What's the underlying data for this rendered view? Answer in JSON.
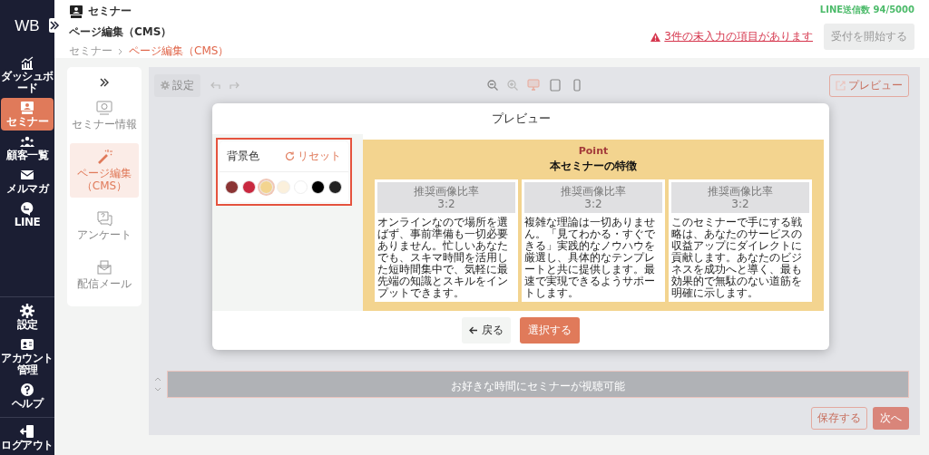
{
  "sidebar": {
    "logo": "WB",
    "items": [
      {
        "label": "ダッシュボード",
        "selected": false
      },
      {
        "label": "セミナー",
        "selected": true
      },
      {
        "label": "顧客一覧",
        "selected": false
      },
      {
        "label": "メルマガ",
        "selected": false
      },
      {
        "label": "LINE",
        "selected": false
      }
    ],
    "bottom_items": [
      {
        "label": "設定"
      },
      {
        "label": "アカウント管理"
      },
      {
        "label": "ヘルプ"
      }
    ],
    "logout": "ログアウト"
  },
  "header": {
    "title": "セミナー",
    "page_title": "ページ編集（CMS）",
    "breadcrumbs": [
      "セミナー",
      "ページ編集（CMS）"
    ],
    "line_quota": "LINE送信数 94/5000",
    "warning": "3件の未入力の項目があります",
    "start_button": {
      "label": "受付を開始する",
      "disabled": true
    }
  },
  "subnav": {
    "items": [
      {
        "label": "セミナー情報",
        "selected": false
      },
      {
        "label": "ページ編集（CMS）",
        "selected": true
      },
      {
        "label": "アンケート",
        "selected": false
      },
      {
        "label": "配信メール",
        "selected": false
      }
    ]
  },
  "editor": {
    "settings_button": "設定",
    "preview_button": "プレビュー",
    "devices": [
      {
        "selected": true
      },
      {
        "selected": false
      },
      {
        "selected": false
      }
    ],
    "section_text": "お好きな時間にセミナーが視聴可能",
    "save_button": "保存する",
    "next_button": "次へ"
  },
  "modal": {
    "title": "プレビュー",
    "background_panel": {
      "label": "背景色",
      "reset": "リセット",
      "swatches": [
        {
          "color": "#8b3434",
          "selected": false
        },
        {
          "color": "#c9283f",
          "selected": false
        },
        {
          "color": "#f3d48f",
          "selected": true
        },
        {
          "color": "#fbf0dc",
          "selected": false
        },
        {
          "color": "#ffffff",
          "selected": false
        },
        {
          "color": "#000000",
          "selected": false
        },
        {
          "color": "#222222",
          "selected": false
        }
      ]
    },
    "preview": {
      "eyebrow": "Point",
      "heading": "本セミナーの特徴",
      "cards": [
        {
          "image_label": "推奨画像比率",
          "image_ratio": "3:2",
          "body": "オンラインなので場所を選ばず、事前準備も一切必要ありません。忙しいあなたでも、スキマ時間を活用した短時間集中で、気軽に最先端の知識とスキルをインプットできます。"
        },
        {
          "image_label": "推奨画像比率",
          "image_ratio": "3:2",
          "body": "複雑な理論は一切ありません。「見てわかる・すぐできる」実践的なノウハウを厳選し、具体的なテンプレートと共に提供します。最速で実現できるようサポートします。"
        },
        {
          "image_label": "推奨画像比率",
          "image_ratio": "3:2",
          "body": "このセミナーで手にする戦略は、あなたのサービスの収益アップにダイレクトに貢献します。あなたのビジネスを成功へと導く、最も効果的で無駄のない道筋を明確に示します。"
        }
      ]
    },
    "back_button": "戻る",
    "select_button": "選択する"
  }
}
